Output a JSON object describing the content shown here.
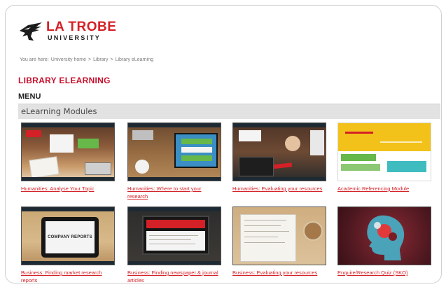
{
  "header": {
    "logo_line1": "LA TROBE",
    "logo_line2": "UNIVERSITY",
    "logo_icon": "eagle-logo-icon"
  },
  "breadcrumb": {
    "prefix": "You are here:",
    "items": [
      "University home",
      ">",
      "Library",
      ">",
      "Library eLearning"
    ]
  },
  "page": {
    "title": "LIBRARY ELEARNING",
    "menu_label": "MENU",
    "section_title": "eLearning Modules"
  },
  "modules": [
    {
      "label": "Humanities: Analyse Your Topic"
    },
    {
      "label": "Humanities: Where to start your research"
    },
    {
      "label": "Humanities: Evaluating your resources"
    },
    {
      "label": "Academic Referencing Module"
    },
    {
      "label": "Business: Finding market research reports"
    },
    {
      "label": "Business: Finding newspaper & journal articles"
    },
    {
      "label": "Business: Evaluating your resources"
    },
    {
      "label": "Enquire/Research Quiz (SKO)"
    }
  ],
  "thumb_text": {
    "company_reports": "COMPANY REPORTS"
  },
  "colors": {
    "brand_red": "#d42027",
    "section_bar": "#e2e2e2"
  }
}
